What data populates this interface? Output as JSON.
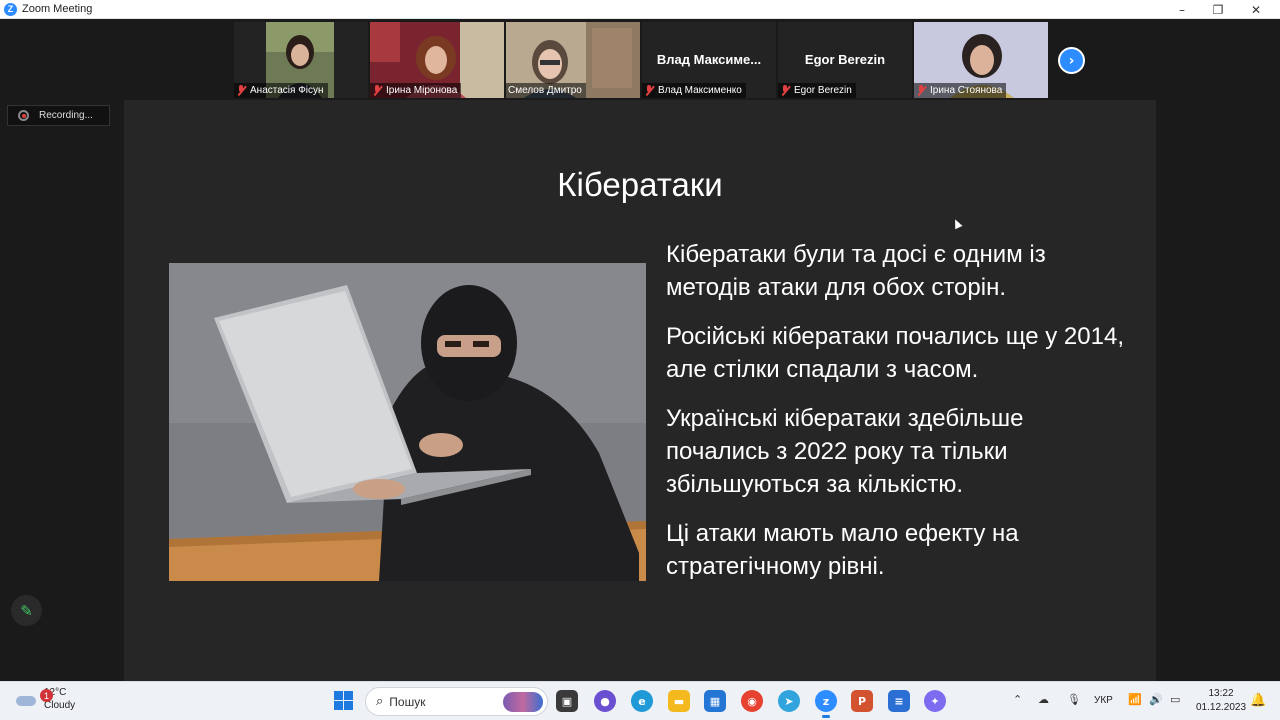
{
  "window": {
    "title": "Zoom Meeting",
    "controls": {
      "minimize": "–",
      "maximize": "❐",
      "close": "✕"
    }
  },
  "participants": [
    {
      "name": "Анастасія Фісун",
      "has_video": true,
      "muted": true
    },
    {
      "name": "Ірина Міронова",
      "has_video": true,
      "muted": true
    },
    {
      "name": "Смелов Дмитро",
      "has_video": true,
      "muted": false,
      "active_speaker": true
    },
    {
      "name": "Влад Максименко",
      "display_name": "Влад  Максиме...",
      "has_video": false,
      "muted": true
    },
    {
      "name": "Egor Berezin",
      "display_name": "Egor Berezin",
      "has_video": false,
      "muted": true
    },
    {
      "name": "Ірина Стоянова",
      "has_video": true,
      "muted": true
    }
  ],
  "next_page_icon": "chevron-right",
  "recording": {
    "label": "Recording..."
  },
  "slide": {
    "title": "Кібератаки",
    "image_description_icon": "hooded-hacker-with-laptop-photo",
    "bullets": [
      "Кібератаки були та досі є одним із методів атаки для обох сторін.",
      "Російські кібератаки почались ще у 2014, але стілки спадали з часом.",
      "Українські кібератаки здебільше почались з 2022 року та тільки збільшуються за кількістю.",
      "Ці атаки мають мало ефекту на стратегічному рівні."
    ]
  },
  "annotate_icon": "pencil-icon",
  "taskbar": {
    "weather": {
      "badge": "1",
      "temp": "12°C",
      "condition": "Cloudy"
    },
    "search_placeholder": "Пошук",
    "language": "УКР",
    "time": "13:22",
    "date": "01.12.2023",
    "apps": [
      "task-view",
      "chat",
      "edge",
      "file-explorer",
      "store",
      "chrome",
      "telegram",
      "zoom",
      "powerpoint",
      "notepad",
      "copilot"
    ]
  },
  "colors": {
    "zoom_blue": "#2d8cff",
    "muted_red": "#e04040",
    "active_speaker": "#e5c84a",
    "slide_bg": "#262626",
    "app_bg": "#1a1a1a"
  }
}
